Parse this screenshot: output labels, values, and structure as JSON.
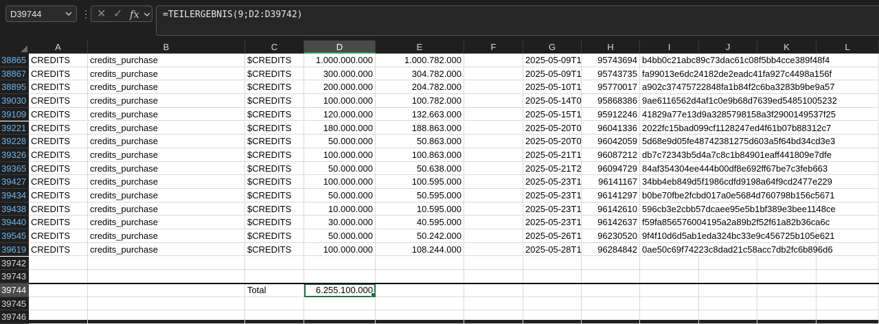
{
  "name_box": "D39744",
  "formula": "=TEILERGEBNIS(9;D2:D39742)",
  "columns": [
    "A",
    "B",
    "C",
    "D",
    "E",
    "F",
    "G",
    "H",
    "I",
    "J",
    "K",
    "L"
  ],
  "selected_column": "D",
  "rows": [
    {
      "num": "38865",
      "a": "CREDITS",
      "b": "credits_purchase",
      "c": "$CREDITS",
      "d": "1.000.000.000",
      "e": "1.000.782.000",
      "g": "2025-05-09T1",
      "h": "95743694",
      "i": "b4bb0c21abc89c73dac61c08f5bb4cce389f48f4"
    },
    {
      "num": "38867",
      "a": "CREDITS",
      "b": "credits_purchase",
      "c": "$CREDITS",
      "d": "300.000.000",
      "e": "304.782.000",
      "g": "2025-05-09T1",
      "h": "95743735",
      "i": "fa99013e6dc24182de2eadc41fa927c4498a156f"
    },
    {
      "num": "38895",
      "a": "CREDITS",
      "b": "credits_purchase",
      "c": "$CREDITS",
      "d": "200.000.000",
      "e": "204.782.000",
      "g": "2025-05-10T1",
      "h": "95770017",
      "i": "a902c37475722848fa1b84f2c6ba3283b9be9a57"
    },
    {
      "num": "39030",
      "a": "CREDITS",
      "b": "credits_purchase",
      "c": "$CREDITS",
      "d": "100.000.000",
      "e": "100.782.000",
      "g": "2025-05-14T0",
      "h": "95868386",
      "i": "9ae6116562d4af1c0e9b68d7639ed54851005232"
    },
    {
      "num": "39109",
      "a": "CREDITS",
      "b": "credits_purchase",
      "c": "$CREDITS",
      "d": "120.000.000",
      "e": "132.663.000",
      "g": "2025-05-15T1",
      "h": "95912246",
      "i": "41829a77e13d9a3285798158a3f2900149537f25"
    },
    {
      "num": "39221",
      "a": "CREDITS",
      "b": "credits_purchase",
      "c": "$CREDITS",
      "d": "180.000.000",
      "e": "188.863.000",
      "g": "2025-05-20T0",
      "h": "96041336",
      "i": "2022fc15bad099cf1128247ed4f61b07b88312c7"
    },
    {
      "num": "39228",
      "a": "CREDITS",
      "b": "credits_purchase",
      "c": "$CREDITS",
      "d": "50.000.000",
      "e": "50.863.000",
      "g": "2025-05-20T0",
      "h": "96042059",
      "i": "5d68e9d05fe48742381275d603a5f64bd34cd3e3"
    },
    {
      "num": "39326",
      "a": "CREDITS",
      "b": "credits_purchase",
      "c": "$CREDITS",
      "d": "100.000.000",
      "e": "100.863.000",
      "g": "2025-05-21T1",
      "h": "96087212",
      "i": "db7c72343b5d4a7c8c1b84901eaff441809e7dfe"
    },
    {
      "num": "39365",
      "a": "CREDITS",
      "b": "credits_purchase",
      "c": "$CREDITS",
      "d": "50.000.000",
      "e": "50.638.000",
      "g": "2025-05-21T2",
      "h": "96094729",
      "i": "84af354304ee444b00df8e692ff67be7c3feb663"
    },
    {
      "num": "39427",
      "a": "CREDITS",
      "b": "credits_purchase",
      "c": "$CREDITS",
      "d": "100.000.000",
      "e": "100.595.000",
      "g": "2025-05-23T1",
      "h": "96141167",
      "i": "34bb4eb849d5f1986cdfd9198a64f9cd2477e229"
    },
    {
      "num": "39434",
      "a": "CREDITS",
      "b": "credits_purchase",
      "c": "$CREDITS",
      "d": "50.000.000",
      "e": "50.595.000",
      "g": "2025-05-23T1",
      "h": "96141297",
      "i": "b0be70fbe2fcbd017a0e5684d760798b156c5671"
    },
    {
      "num": "39438",
      "a": "CREDITS",
      "b": "credits_purchase",
      "c": "$CREDITS",
      "d": "10.000.000",
      "e": "10.595.000",
      "g": "2025-05-23T1",
      "h": "96142610",
      "i": "596cb3e2cbb57dcaee95e5b1bf389e3bee1148ce"
    },
    {
      "num": "39440",
      "a": "CREDITS",
      "b": "credits_purchase",
      "c": "$CREDITS",
      "d": "30.000.000",
      "e": "40.595.000",
      "g": "2025-05-23T1",
      "h": "96142637",
      "i": "f59fa856576004195a2a89b2f52f61a82b36ca6c"
    },
    {
      "num": "39545",
      "a": "CREDITS",
      "b": "credits_purchase",
      "c": "$CREDITS",
      "d": "50.000.000",
      "e": "50.242.000",
      "g": "2025-05-26T1",
      "h": "96230520",
      "i": "9f4f10d6d5ab1eda324bc33e9c456725b105e621"
    },
    {
      "num": "39619",
      "a": "CREDITS",
      "b": "credits_purchase",
      "c": "$CREDITS",
      "d": "100.000.000",
      "e": "108.244.000",
      "g": "2025-05-28T1",
      "h": "96284842",
      "i": "0ae50c69f74223c8dad21c58acc7db2fc6b896d6"
    },
    {
      "num": "39742",
      "a": "",
      "b": "",
      "c": "",
      "d": "",
      "e": "",
      "g": "",
      "h": "",
      "i": ""
    },
    {
      "num": "39743",
      "a": "",
      "b": "",
      "c": "",
      "d": "",
      "e": "",
      "g": "",
      "h": "",
      "i": ""
    },
    {
      "num": "39744",
      "a": "",
      "b": "",
      "c": "Total",
      "d": "6.255.100.000",
      "e": "",
      "g": "",
      "h": "",
      "i": ""
    },
    {
      "num": "39745",
      "a": "",
      "b": "",
      "c": "",
      "d": "",
      "e": "",
      "g": "",
      "h": "",
      "i": ""
    },
    {
      "num": "39746",
      "a": "",
      "b": "",
      "c": "",
      "d": "",
      "e": "",
      "g": "",
      "h": "",
      "i": ""
    }
  ],
  "selected_row": "39744",
  "accent_color": "#1e7145"
}
